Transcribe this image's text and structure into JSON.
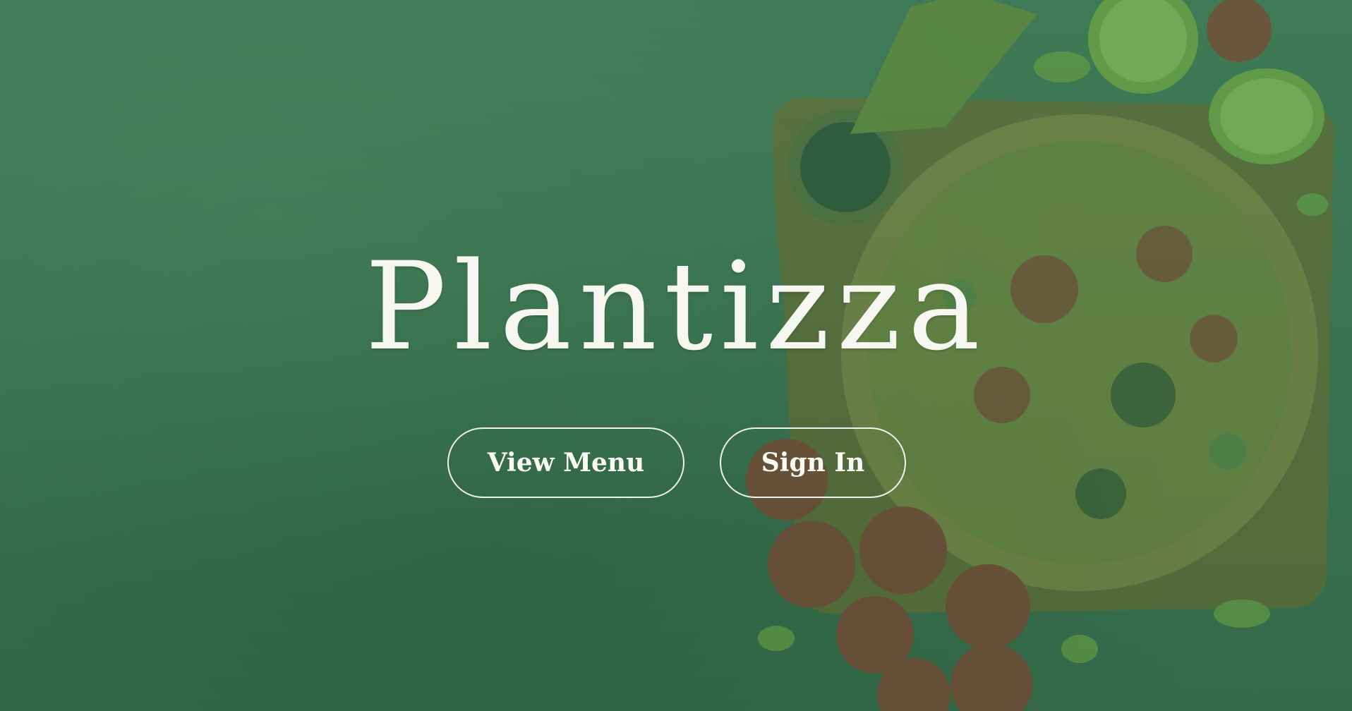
{
  "hero": {
    "title": "Plantizza",
    "background_image": "pizza-with-tomatoes-and-lime-on-green-table"
  },
  "actions": {
    "view_menu_label": "View Menu",
    "sign_in_label": "Sign In"
  },
  "colors": {
    "overlay_green": "#3f7550",
    "text": "#f7f7f2",
    "button_border": "#f2f2ee"
  }
}
